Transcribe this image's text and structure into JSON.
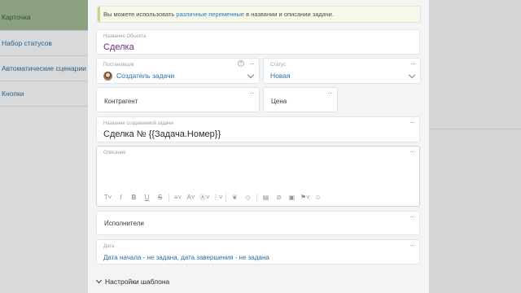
{
  "sidebar": {
    "items": [
      {
        "label": "Карточка"
      },
      {
        "label": "Набор статусов"
      },
      {
        "label": "Автоматические сценарии"
      },
      {
        "label": "Кнопки"
      }
    ]
  },
  "banner": {
    "before": "Вы можете использовать ",
    "link": "различные переменные",
    "after": " в названии и описании задачи."
  },
  "object_name": {
    "label": "Название Объекта",
    "value": "Сделка"
  },
  "setter": {
    "label": "Постановщик",
    "value": "Создатель задачи"
  },
  "status": {
    "label": "Статус",
    "value": "Новая"
  },
  "counterparty": {
    "label": "Контрагент"
  },
  "price": {
    "label": "Цена"
  },
  "task_name": {
    "label": "Название создаваемой задачи",
    "value": "Сделка № {{Задача.Номер}}"
  },
  "description": {
    "label": "Описание",
    "value": ""
  },
  "assignees": {
    "label": "Исполнители"
  },
  "date": {
    "label": "Дата",
    "value": "Дата начала - не задана, дата завершения - не задана"
  },
  "template_settings": {
    "label": "Настройки шаблона"
  },
  "dots": "···",
  "colors": {
    "active_sidebar": "#8aa081",
    "link": "#2b77c0",
    "accent_text": "#6a2b86"
  },
  "toolbar_icons": [
    "text-size-icon",
    "italic-icon",
    "bold-icon",
    "underline-icon",
    "strikethrough-icon",
    "align-icon",
    "font-color-icon",
    "highlight-icon",
    "list-icon",
    "link-icon",
    "eraser-icon",
    "table-icon",
    "attach-icon",
    "image-icon",
    "flag-icon",
    "emoji-icon"
  ]
}
